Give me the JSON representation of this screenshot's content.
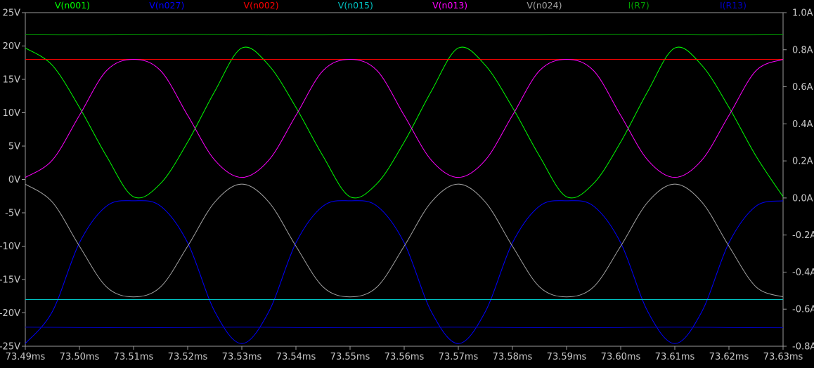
{
  "chart_data": {
    "type": "line",
    "background": "#000000",
    "grid": false,
    "legend_position": "top",
    "x_axis": {
      "range": [
        73.49,
        73.63
      ],
      "unit": "ms",
      "tick_values": [
        73.49,
        73.5,
        73.51,
        73.52,
        73.53,
        73.54,
        73.55,
        73.56,
        73.57,
        73.58,
        73.59,
        73.6,
        73.61,
        73.62,
        73.63
      ],
      "tick_labels": [
        "73.49ms",
        "73.50ms",
        "73.51ms",
        "73.52ms",
        "73.53ms",
        "73.54ms",
        "73.55ms",
        "73.56ms",
        "73.57ms",
        "73.58ms",
        "73.59ms",
        "73.60ms",
        "73.61ms",
        "73.62ms",
        "73.63ms"
      ]
    },
    "y_left": {
      "range": [
        -25,
        25
      ],
      "unit": "V",
      "tick_values": [
        25,
        20,
        15,
        10,
        5,
        0,
        -5,
        -10,
        -15,
        -20,
        -25
      ],
      "tick_labels": [
        "25V",
        "20V",
        "15V",
        "10V",
        "5V",
        "0V",
        "-5V",
        "-10V",
        "-15V",
        "-20V",
        "-25V"
      ]
    },
    "y_right": {
      "range": [
        -0.8,
        1.0
      ],
      "unit": "A",
      "tick_values": [
        1.0,
        0.8,
        0.6,
        0.4,
        0.2,
        0.0,
        -0.2,
        -0.4,
        -0.6,
        -0.8
      ],
      "tick_labels": [
        "1.0A",
        "0.8A",
        "0.6A",
        "0.4A",
        "0.2A",
        "0.0A",
        "-0.2A",
        "-0.4A",
        "-0.6A",
        "-0.8A"
      ]
    },
    "series": [
      {
        "name": "V(n001)",
        "color": "#00ff00",
        "axis": "left",
        "x": [
          73.49,
          73.495,
          73.5,
          73.505,
          73.51,
          73.515,
          73.52,
          73.525,
          73.53,
          73.535,
          73.54,
          73.545,
          73.55,
          73.555,
          73.56,
          73.565,
          73.57,
          73.575,
          73.58,
          73.585,
          73.59,
          73.595,
          73.6,
          73.605,
          73.61,
          73.615,
          73.62,
          73.625,
          73.63
        ],
        "y": [
          19.7,
          17.1,
          10.8,
          3.5,
          -2.6,
          -0.6,
          5.6,
          13.2,
          19.7,
          17.1,
          10.8,
          3.5,
          -2.6,
          -0.6,
          5.6,
          13.2,
          19.7,
          17.1,
          10.8,
          3.5,
          -2.6,
          -0.6,
          5.6,
          13.2,
          19.7,
          17.1,
          10.8,
          3.5,
          -2.6
        ]
      },
      {
        "name": "V(n027)",
        "color": "#0000ff",
        "axis": "left",
        "x": [
          73.49,
          73.495,
          73.5,
          73.505,
          73.51,
          73.515,
          73.52,
          73.525,
          73.53,
          73.535,
          73.54,
          73.545,
          73.55,
          73.555,
          73.56,
          73.565,
          73.57,
          73.575,
          73.58,
          73.585,
          73.59,
          73.595,
          73.6,
          73.605,
          73.61,
          73.615,
          73.62,
          73.625,
          73.63
        ],
        "y": [
          -24.6,
          -19.8,
          -9.5,
          -4.0,
          -3.2,
          -4.0,
          -9.5,
          -19.8,
          -24.6,
          -19.8,
          -9.5,
          -4.0,
          -3.2,
          -4.0,
          -9.5,
          -19.8,
          -24.6,
          -19.8,
          -9.5,
          -4.0,
          -3.2,
          -4.0,
          -9.5,
          -19.8,
          -24.6,
          -19.8,
          -9.5,
          -4.0,
          -3.2
        ]
      },
      {
        "name": "V(n002)",
        "color": "#ff0000",
        "axis": "left",
        "x": [
          73.49,
          73.63
        ],
        "y": [
          18.0,
          18.0
        ]
      },
      {
        "name": "V(n015)",
        "color": "#00c0c0",
        "axis": "left",
        "x": [
          73.49,
          73.63
        ],
        "y": [
          -18.0,
          -18.0
        ]
      },
      {
        "name": "V(n013)",
        "color": "#ff00ff",
        "axis": "left",
        "x": [
          73.49,
          73.495,
          73.5,
          73.505,
          73.51,
          73.515,
          73.52,
          73.525,
          73.53,
          73.535,
          73.54,
          73.545,
          73.55,
          73.555,
          73.56,
          73.565,
          73.57,
          73.575,
          73.58,
          73.585,
          73.59,
          73.595,
          73.6,
          73.605,
          73.61,
          73.615,
          73.62,
          73.625,
          73.63
        ],
        "y": [
          0.3,
          2.9,
          9.6,
          16.3,
          18.0,
          16.3,
          9.6,
          2.9,
          0.3,
          2.9,
          9.6,
          16.3,
          18.0,
          16.3,
          9.6,
          2.9,
          0.3,
          2.9,
          9.6,
          16.3,
          18.0,
          16.3,
          9.6,
          2.9,
          0.3,
          2.9,
          9.6,
          16.3,
          18.0
        ]
      },
      {
        "name": "V(n024)",
        "color": "#a0a0a0",
        "axis": "left",
        "x": [
          73.49,
          73.495,
          73.5,
          73.505,
          73.51,
          73.515,
          73.52,
          73.525,
          73.53,
          73.535,
          73.54,
          73.545,
          73.55,
          73.555,
          73.56,
          73.565,
          73.57,
          73.575,
          73.58,
          73.585,
          73.59,
          73.595,
          73.6,
          73.605,
          73.61,
          73.615,
          73.62,
          73.625,
          73.63
        ],
        "y": [
          -0.7,
          -3.4,
          -10.0,
          -16.1,
          -17.6,
          -16.1,
          -10.0,
          -3.4,
          -0.7,
          -3.4,
          -10.0,
          -16.1,
          -17.6,
          -16.1,
          -10.0,
          -3.4,
          -0.7,
          -3.4,
          -10.0,
          -16.1,
          -17.6,
          -16.1,
          -10.0,
          -3.4,
          -0.7,
          -3.4,
          -10.0,
          -16.1,
          -17.6
        ]
      },
      {
        "name": "I(R7)",
        "color": "#00a000",
        "axis": "right",
        "x": [
          73.49,
          73.5,
          73.51,
          73.52,
          73.53,
          73.54,
          73.55,
          73.56,
          73.57,
          73.58,
          73.59,
          73.6,
          73.61,
          73.62,
          73.63
        ],
        "y": [
          0.881,
          0.88,
          0.881,
          0.882,
          0.881,
          0.88,
          0.881,
          0.882,
          0.881,
          0.88,
          0.881,
          0.882,
          0.881,
          0.88,
          0.881
        ]
      },
      {
        "name": "I(R13)",
        "color": "#0000c0",
        "axis": "right",
        "x": [
          73.49,
          73.5,
          73.51,
          73.52,
          73.53,
          73.54,
          73.55,
          73.56,
          73.57,
          73.58,
          73.59,
          73.6,
          73.61,
          73.62,
          73.63
        ],
        "y": [
          -0.697,
          -0.699,
          -0.7,
          -0.699,
          -0.697,
          -0.699,
          -0.7,
          -0.699,
          -0.697,
          -0.699,
          -0.7,
          -0.699,
          -0.697,
          -0.699,
          -0.7
        ]
      }
    ]
  }
}
